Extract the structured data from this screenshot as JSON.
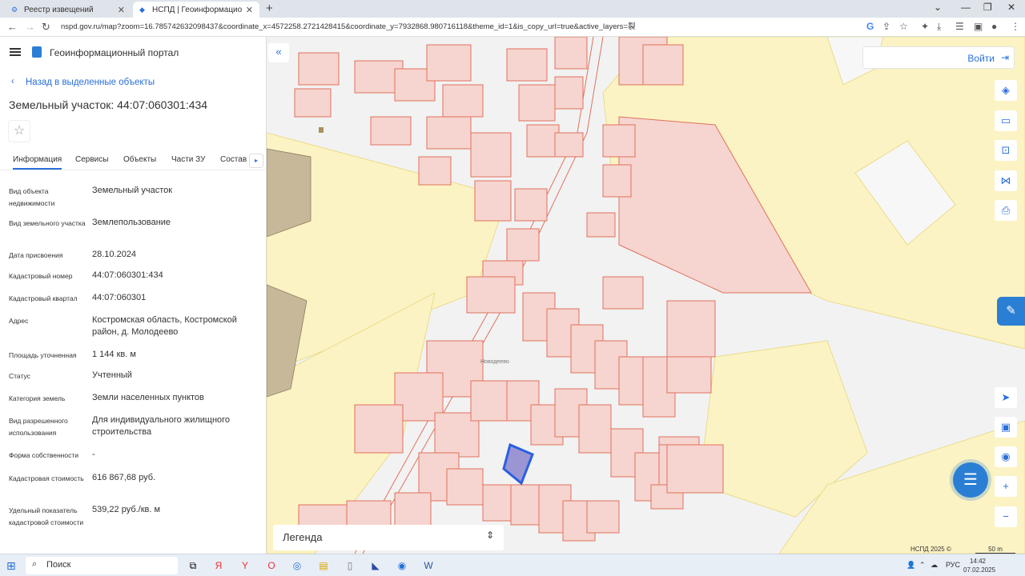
{
  "browser": {
    "tabs": [
      {
        "label": "Реестр извещений",
        "icon": "site-icon"
      },
      {
        "label": "НСПД | Геоинформационный п",
        "icon": "nspd-icon"
      }
    ],
    "url": "nspd.gov.ru/map?zoom=16.785742632098437&coordinate_x=4572258.2721428415&coordinate_y=7932868.980716118&theme_id=1&is_copy_url=true&active_layers=裂"
  },
  "panel": {
    "portal_title": "Геоинформационный портал",
    "back_label": "Назад в выделенные объекты",
    "title": "Земельный участок: 44:07:060301:434",
    "tabs": [
      "Информация",
      "Сервисы",
      "Объекты",
      "Части ЗУ",
      "Состав"
    ],
    "rows": [
      {
        "key": "Вид объекта недвижимости",
        "value": "Земельный участок"
      },
      {
        "key": "Вид земельного участка",
        "value": "Землепользование"
      },
      {
        "key": "Дата присвоения",
        "value": "28.10.2024"
      },
      {
        "key": "Кадастровый номер",
        "value": "44:07:060301:434"
      },
      {
        "key": "Кадастровый квартал",
        "value": "44:07:060301"
      },
      {
        "key": "Адрес",
        "value": "Костромская область, Костромской район, д. Молодеево"
      },
      {
        "key": "Площадь уточненная",
        "value": "1 144 кв. м"
      },
      {
        "key": "Статус",
        "value": "Учтенный"
      },
      {
        "key": "Категория земель",
        "value": "Земли населенных пунктов"
      },
      {
        "key": "Вид разрешенного использования",
        "value": "Для индивидуального жилищного строительства"
      },
      {
        "key": "Форма собственности",
        "value": "-"
      },
      {
        "key": "Кадастровая стоимость",
        "value": "616 867,68 руб."
      },
      {
        "key": "Удельный показатель кадастровой стоимости",
        "value": "539,22 руб./кв. м"
      }
    ]
  },
  "map": {
    "login_label": "Войти",
    "legend_label": "Легенда",
    "copyright": "НСПД 2025 ©",
    "scale": "50 m",
    "village_label": "Новодеево"
  },
  "taskbar": {
    "search_label": "Поиск",
    "lang": "РУС",
    "time": "14:42",
    "date": "07.02.2025"
  },
  "colors": {
    "accent": "#2a6fdb",
    "parcel_fill": "#f6d4cf",
    "parcel_stroke": "#e0725e",
    "zone_fill": "#fbf3c3",
    "selected": "#2a5fe0"
  }
}
